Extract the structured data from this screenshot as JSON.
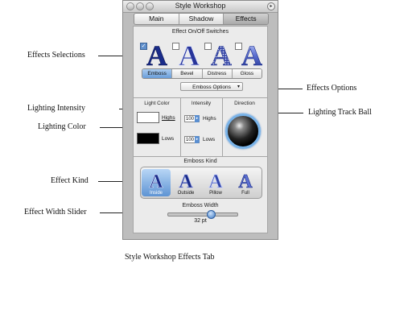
{
  "window": {
    "title": "Style Workshop",
    "tabs": [
      {
        "label": "Main",
        "active": false
      },
      {
        "label": "Shadow",
        "active": false
      },
      {
        "label": "Effects",
        "active": true
      }
    ]
  },
  "effects": {
    "switches_header": "Effect On/Off Switches",
    "switches": [
      {
        "effect": "Emboss",
        "checked": true,
        "glyph": "A"
      },
      {
        "effect": "Bevel",
        "checked": false,
        "glyph": "A"
      },
      {
        "effect": "Distress",
        "checked": false,
        "glyph": "A"
      },
      {
        "effect": "Gloss",
        "checked": false,
        "glyph": "A"
      }
    ],
    "segments": [
      {
        "label": "Emboss",
        "active": true
      },
      {
        "label": "Bevel",
        "active": false
      },
      {
        "label": "Distress",
        "active": false
      },
      {
        "label": "Gloss",
        "active": false
      }
    ],
    "options_popup": "Emboss Options",
    "light_color_header": "Light Color",
    "intensity_header": "Intensity",
    "direction_header": "Direction",
    "highs_label": "Highs",
    "lows_label": "Lows",
    "highs_color": "#ffffff",
    "lows_color": "#000000",
    "intensity_highs": "100",
    "intensity_lows": "100",
    "emboss_kind_header": "Emboss Kind",
    "kinds": [
      {
        "label": "Inside",
        "active": true
      },
      {
        "label": "Outside",
        "active": false
      },
      {
        "label": "Pillow",
        "active": false
      },
      {
        "label": "Full",
        "active": false
      }
    ],
    "width_header": "Emboss Width",
    "width_value": "32 pt",
    "width_fraction": 0.62
  },
  "callouts": {
    "effects_selections": "Effects Selections",
    "effects_options": "Effects Options",
    "lighting_intensity": "Lighting Intensity",
    "lighting_track_ball": "Lighting Track Ball",
    "lighting_color": "Lighting Color",
    "effect_kind": "Effect Kind",
    "effect_width_slider": "Effect Width Slider"
  },
  "caption": "Style Workshop Effects Tab",
  "colors": {
    "accent": "#5b8fd0",
    "glyph_dark": "#1a2c8a",
    "glyph_light": "#dfe6ff"
  },
  "icons": [
    "checkmark-icon",
    "popup-arrow-icon",
    "stepper-arrow-icon",
    "zoom-icon"
  ]
}
